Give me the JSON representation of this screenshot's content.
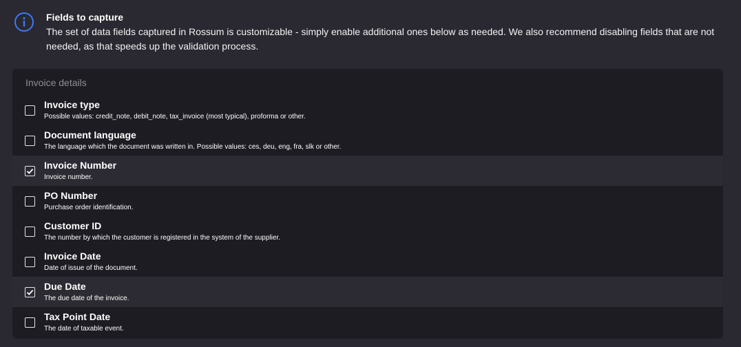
{
  "info": {
    "icon": "info-circle-icon",
    "accent_color": "#3a7bf2",
    "title": "Fields to capture",
    "text": "The set of data fields captured in Rossum is customizable - simply enable additional ones below as needed. We also recommend disabling fields that are not needed, as that speeds up the validation process."
  },
  "panel": {
    "title": "Invoice details",
    "fields": [
      {
        "label": "Invoice type",
        "description": "Possible values: credit_note, debit_note, tax_invoice (most typical), proforma or other.",
        "checked": false
      },
      {
        "label": "Document language",
        "description": "The language which the document was written in. Possible values: ces, deu, eng, fra, slk or other.",
        "checked": false
      },
      {
        "label": "Invoice Number",
        "description": "Invoice number.",
        "checked": true
      },
      {
        "label": "PO Number",
        "description": "Purchase order identification.",
        "checked": false
      },
      {
        "label": "Customer ID",
        "description": "The number by which the customer is registered in the system of the supplier.",
        "checked": false
      },
      {
        "label": "Invoice Date",
        "description": "Date of issue of the document.",
        "checked": false
      },
      {
        "label": "Due Date",
        "description": "The due date of the invoice.",
        "checked": true
      },
      {
        "label": "Tax Point Date",
        "description": "The date of taxable event.",
        "checked": false
      }
    ]
  }
}
